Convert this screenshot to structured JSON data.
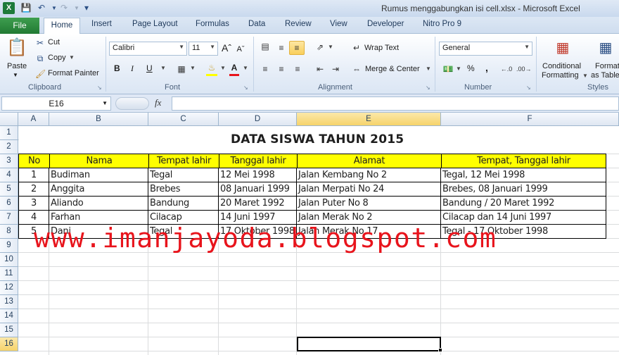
{
  "window": {
    "title": "Rumus menggabungkan isi cell.xlsx  -  Microsoft Excel",
    "app_icon": "excel-icon"
  },
  "quick_access": {
    "save_icon": "save-icon",
    "undo_icon": "undo-icon",
    "redo_icon": "redo-icon"
  },
  "tabs": {
    "file": "File",
    "home": "Home",
    "insert": "Insert",
    "page_layout": "Page Layout",
    "formulas": "Formulas",
    "data": "Data",
    "review": "Review",
    "view": "View",
    "developer": "Developer",
    "nitro": "Nitro Pro 9"
  },
  "ribbon": {
    "clipboard": {
      "paste": "Paste",
      "cut": "Cut",
      "copy": "Copy",
      "format_painter": "Format Painter",
      "label": "Clipboard"
    },
    "font": {
      "name": "Calibri",
      "size": "11",
      "bold": "B",
      "italic": "I",
      "underline": "U",
      "label": "Font"
    },
    "alignment": {
      "wrap_text": "Wrap Text",
      "merge_center": "Merge & Center",
      "label": "Alignment"
    },
    "number": {
      "format": "General",
      "percent": "%",
      "comma": ",",
      "label": "Number"
    },
    "styles": {
      "conditional_1": "Conditional",
      "conditional_2": "Formatting",
      "format_as_1": "Format",
      "format_as_2": "as Table",
      "label": "Styles"
    }
  },
  "formula_bar": {
    "name_box": "E16",
    "fx": "fx",
    "content": ""
  },
  "sheet": {
    "columns": [
      "A",
      "B",
      "C",
      "D",
      "E",
      "F"
    ],
    "rows": [
      "1",
      "2",
      "3",
      "4",
      "5",
      "6",
      "7",
      "8",
      "9",
      "10",
      "11",
      "12",
      "13",
      "14",
      "15",
      "16"
    ],
    "title": "DATA SISWA TAHUN 2015",
    "headers": [
      "No",
      "Nama",
      "Tempat lahir",
      "Tanggal lahir",
      "Alamat",
      "Tempat, Tanggal lahir"
    ],
    "records": [
      [
        "1",
        "Budiman",
        "Tegal",
        " 12 Mei 1998",
        "Jalan Kembang No 2",
        "Tegal, 12 Mei 1998"
      ],
      [
        "2",
        "Anggita",
        "Brebes",
        " 08 Januari 1999",
        "Jalan Merpati No 24",
        "Brebes, 08 Januari 1999"
      ],
      [
        "3",
        "Aliando",
        "Bandung",
        "20 Maret 1992",
        "Jalan Puter No 8",
        "Bandung / 20 Maret 1992"
      ],
      [
        "4",
        "Farhan",
        "Cilacap",
        "14 Juni 1997",
        "Jalan Merak No 2",
        "Cilacap dan 14 Juni 1997"
      ],
      [
        "5",
        "Dani",
        "Tegal",
        "17 Oktober 1998",
        "Jalan Merak No 17",
        "Tegal - 17 Oktober 1998"
      ]
    ],
    "active_column": "E",
    "active_row": "16"
  },
  "watermark": "www.imanjayoda.blogspot.com"
}
